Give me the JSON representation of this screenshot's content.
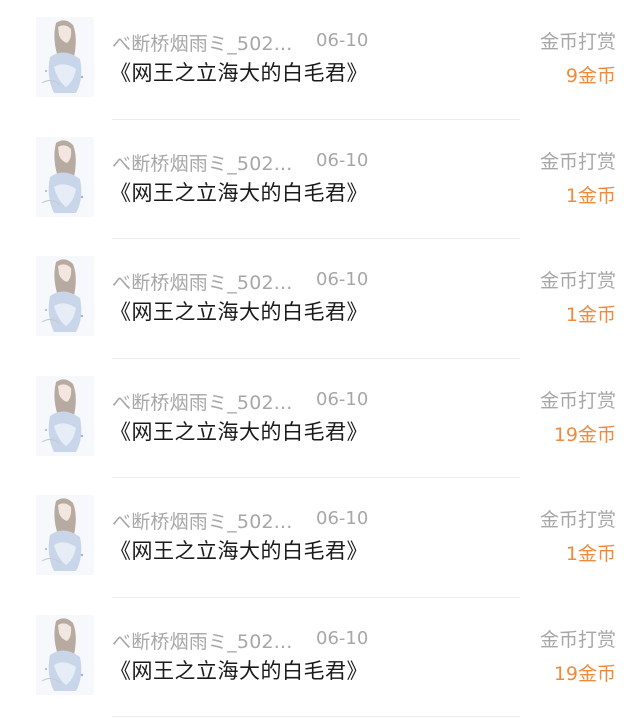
{
  "gifts": [
    {
      "user": "べ断桥烟雨ミ_502...",
      "date": "06-10",
      "title": "《网王之立海大的白毛君》",
      "type": "金币打赏",
      "amount": "9金币"
    },
    {
      "user": "べ断桥烟雨ミ_502...",
      "date": "06-10",
      "title": "《网王之立海大的白毛君》",
      "type": "金币打赏",
      "amount": "1金币"
    },
    {
      "user": "べ断桥烟雨ミ_502...",
      "date": "06-10",
      "title": "《网王之立海大的白毛君》",
      "type": "金币打赏",
      "amount": "1金币"
    },
    {
      "user": "べ断桥烟雨ミ_502...",
      "date": "06-10",
      "title": "《网王之立海大的白毛君》",
      "type": "金币打赏",
      "amount": "19金币"
    },
    {
      "user": "べ断桥烟雨ミ_502...",
      "date": "06-10",
      "title": "《网王之立海大的白毛君》",
      "type": "金币打赏",
      "amount": "1金币"
    },
    {
      "user": "べ断桥烟雨ミ_502...",
      "date": "06-10",
      "title": "《网王之立海大的白毛君》",
      "type": "金币打赏",
      "amount": "19金币"
    }
  ],
  "colors": {
    "amount": "#f08a3c",
    "secondary_text": "#a7a7a7",
    "primary_text": "#1a1a1a",
    "divider": "#ececec"
  }
}
